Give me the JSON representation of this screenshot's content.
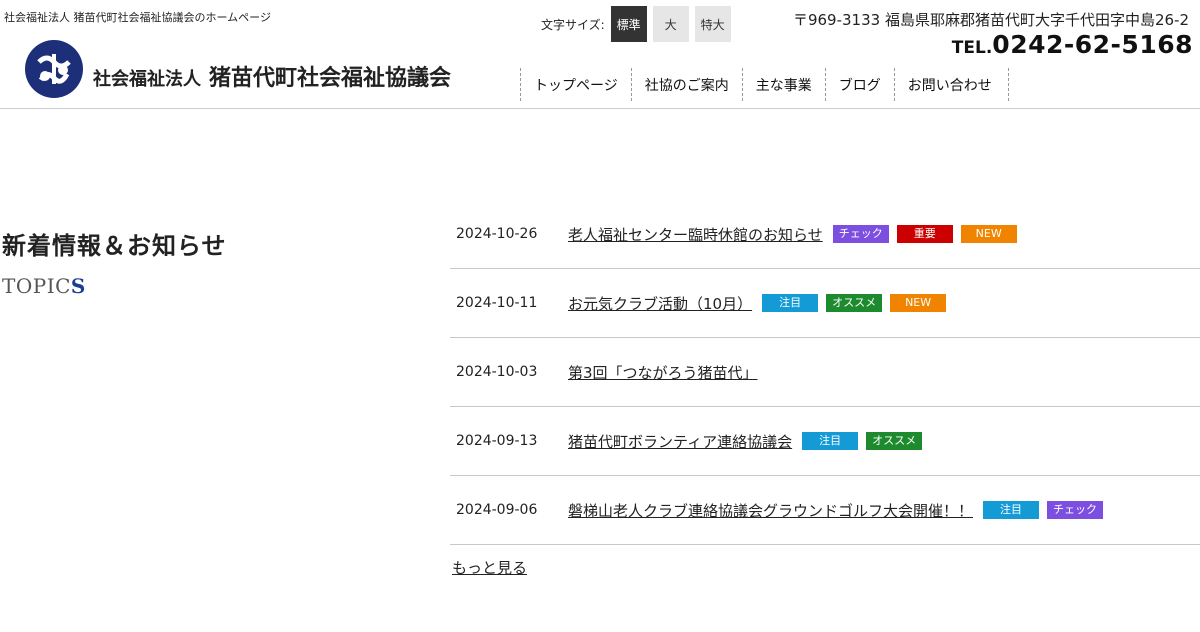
{
  "header": {
    "tagline": "社会福祉法人 猪苗代町社会福祉協議会のホームページ",
    "org_prefix": "社会福祉法人",
    "org_name": "猪苗代町社会福祉協議会",
    "address": "〒969-3133 福島県耶麻郡猪苗代町大字千代田字中島26-2",
    "tel_label": "TEL.",
    "tel_number": "0242-62-5168"
  },
  "font_size": {
    "label": "文字サイズ:",
    "options": [
      "標準",
      "大",
      "特大"
    ],
    "selected": "標準"
  },
  "nav": {
    "items": [
      "トップページ",
      "社協のご案内",
      "主な事業",
      "ブログ",
      "お問い合わせ"
    ]
  },
  "topics": {
    "title": "新着情報＆お知らせ",
    "subtitle_main": "TOPIC",
    "subtitle_accent": "S",
    "more_label": "もっと見る",
    "entries": [
      {
        "date": "2024-10-26",
        "title": "老人福祉センター臨時休館のお知らせ",
        "tags": [
          "チェック",
          "重要",
          "NEW"
        ]
      },
      {
        "date": "2024-10-11",
        "title": "お元気クラブ活動（10月）",
        "tags": [
          "注目",
          "オススメ",
          "NEW"
        ]
      },
      {
        "date": "2024-10-03",
        "title": "第3回「つながろう猪苗代」",
        "tags": []
      },
      {
        "date": "2024-09-13",
        "title": "猪苗代町ボランティア連絡協議会",
        "tags": [
          "注目",
          "オススメ"
        ]
      },
      {
        "date": "2024-09-06",
        "title": "磐梯山老人クラブ連絡協議会グラウンドゴルフ大会開催！！",
        "tags": [
          "注目",
          "チェック"
        ]
      }
    ]
  },
  "tag_colors": {
    "チェック": "#7d4fe0",
    "重要": "#cc0000",
    "NEW": "#f08300",
    "注目": "#149bd6",
    "オススメ": "#1d8a2e"
  },
  "colors": {
    "logo_navy": "#1e2f7a",
    "accent_blue": "#1a3f8f"
  }
}
